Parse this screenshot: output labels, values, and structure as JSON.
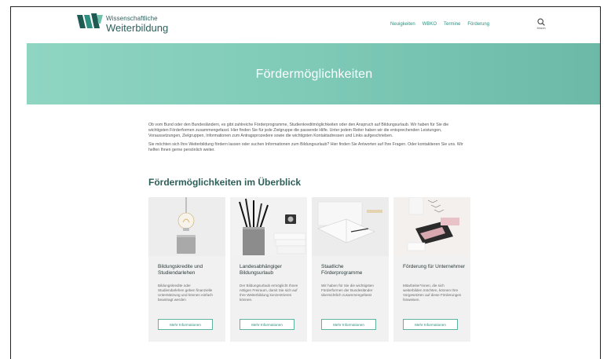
{
  "logo": {
    "line1": "Wissenschaftliche",
    "line2": "Weiterbildung"
  },
  "nav": [
    {
      "label": "Neuigkeiten"
    },
    {
      "label": "WBKO"
    },
    {
      "label": "Termine"
    },
    {
      "label": "Förderung"
    }
  ],
  "search": {
    "label": "Search",
    "icon": "search-icon"
  },
  "hero": {
    "title": "Fördermöglichkeiten"
  },
  "intro": {
    "p1": "Ob vom Bund oder den Bundesländern, es gibt zahlreiche Förderprogramme, Studienkreditmöglichkeiten oder den Anspruch auf Bildungsurlaub. Wir haben für Sie die wichtigsten Förderformen zusammengefasst. Hier finden Sie für jede Zielgruppe die passende Hilfe. Unter jedem Reiter haben wir die entsprechenden Leistungen, Voraussetzungen, Zielgruppen, Informationen zum Antragsprozedere sowie die wichtigsten Kontaktadressen und Links aufgeschrieben.",
    "p2": "Sie möchten sich Ihre Weiterbildung fördern lassen oder suchen Informationen zum Bildungsurlaub? Hier finden Sie Antworten auf Ihre Fragen. Oder kontaktieren Sie uns. Wir helfen Ihnen gerne persönlich weiter."
  },
  "section": {
    "title": "Fördermöglichkeiten im Überblick"
  },
  "cards": [
    {
      "title": "Bildungskredite und Studiendarlehen",
      "text": "Bildungskredite oder Studiendarlehen geben finanzielle Unterstützung und können einfach beantragt werden",
      "button": "Mehr Informationen"
    },
    {
      "title": "Landesabhängiger Bildungsurlaub",
      "text": "Der Bildungsurlaub ermöglicht Ihnen nötigen Freiraum, damit Sie sich auf Ihre Weiterbildung konzentrieren können.",
      "button": "Mehr Informationen"
    },
    {
      "title": "Staatliche Förderprogramme",
      "text": "Wir haben für Sie die wichtigsten Förderformen der Bundesländer übersichtlich zusammengefasst",
      "button": "Mehr Informationen"
    },
    {
      "title": "Förderung für Unternehmer",
      "text": "Mitarbeiter*innen, die sich weiterbilden möchten, können Ihre Vorgesetzten auf diese Förderungen hinweisen.",
      "button": "Mehr Informationen"
    }
  ],
  "colors": {
    "brand": "#2e5f5a",
    "accent": "#2d8f7f",
    "hero": "#7ecab7"
  }
}
